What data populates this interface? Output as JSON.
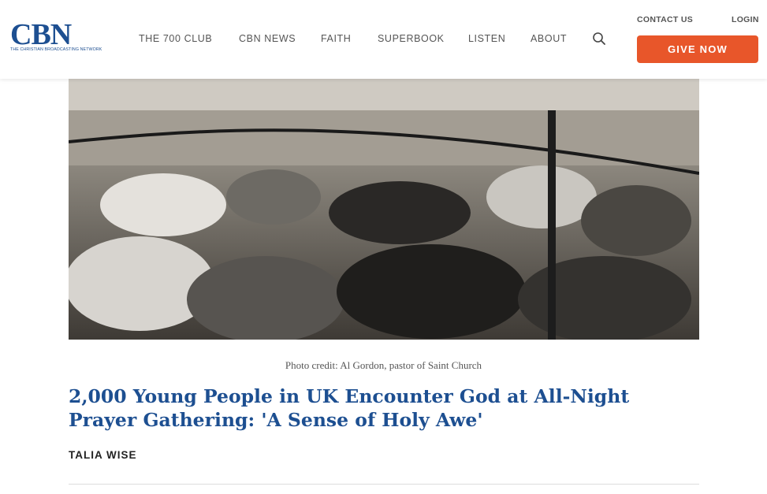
{
  "logo": {
    "text": "CBN",
    "subtitle": "THE CHRISTIAN BROADCASTING NETWORK"
  },
  "nav": [
    {
      "label": "THE 700 CLUB"
    },
    {
      "label": "CBN NEWS"
    },
    {
      "label": "FAITH"
    },
    {
      "label": "SUPERBOOK"
    },
    {
      "label": "LISTEN"
    },
    {
      "label": "ABOUT"
    }
  ],
  "utility": {
    "contact": "CONTACT US",
    "login": "LOGIN"
  },
  "give_button": "GIVE NOW",
  "article": {
    "photo_credit": "Photo credit: Al Gordon, pastor of Saint Church",
    "headline": "2,000 Young People in UK Encounter God at All-Night Prayer Gathering: 'A Sense of Holy Awe'",
    "author": "TALIA WISE"
  },
  "colors": {
    "brand_blue": "#1d4f91",
    "give_orange": "#e8562a",
    "nav_text": "#555555"
  }
}
